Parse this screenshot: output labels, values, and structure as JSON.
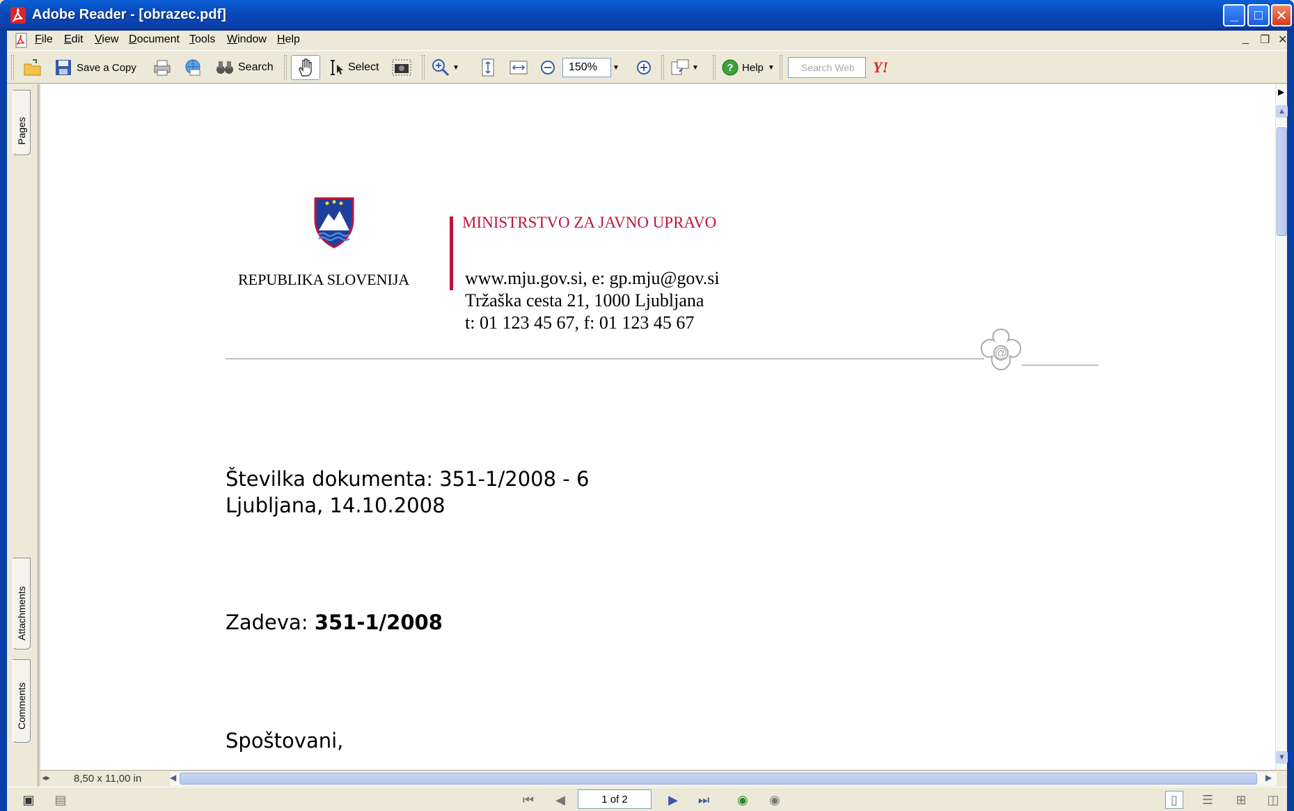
{
  "window": {
    "title": "Adobe Reader - [obrazec.pdf]",
    "controls": {
      "minimize": "_",
      "maximize": "□",
      "close": "✕"
    }
  },
  "menu": {
    "items": [
      {
        "label": "File",
        "underline": "F",
        "rest": "ile"
      },
      {
        "label": "Edit",
        "underline": "E",
        "rest": "dit"
      },
      {
        "label": "View",
        "underline": "V",
        "rest": "iew"
      },
      {
        "label": "Document",
        "underline": "D",
        "rest": "ocument"
      },
      {
        "label": "Tools",
        "underline": "T",
        "rest": "ools"
      },
      {
        "label": "Window",
        "underline": "W",
        "rest": "indow"
      },
      {
        "label": "Help",
        "underline": "H",
        "rest": "elp"
      }
    ],
    "mdi_controls": {
      "minimize": "_",
      "restore": "❐",
      "close": "✕"
    }
  },
  "toolbar": {
    "save_copy_label": "Save a Copy",
    "search_label": "Search",
    "select_label": "Select",
    "zoom_value": "150%",
    "help_label": "Help",
    "search_web_placeholder": "Search Web"
  },
  "navpanel": {
    "tabs": [
      "Pages",
      "Attachments",
      "Comments"
    ]
  },
  "document": {
    "country": "REPUBLIKA SLOVENIJA",
    "ministry": "MINISTRSTVO ZA JAVNO UPRAVO",
    "contact_web": "www.mju.gov.si, e: gp.mju@gov.si",
    "contact_address": "Tržaška cesta 21, 1000 Ljubljana",
    "contact_phone": "t: 01 123 45 67, f: 01 123 45 67",
    "doc_number": "Številka dokumenta: 351-1/2008 - 6",
    "place_date": "Ljubljana, 14.10.2008",
    "subject_label": "Zadeva: ",
    "subject_value": "351-1/2008",
    "greeting": "Spoštovani,",
    "accent_color": "#c0143c"
  },
  "bottombar": {
    "page_size": "8,50 x 11,00 in",
    "page_indicator": "1 of 2"
  }
}
